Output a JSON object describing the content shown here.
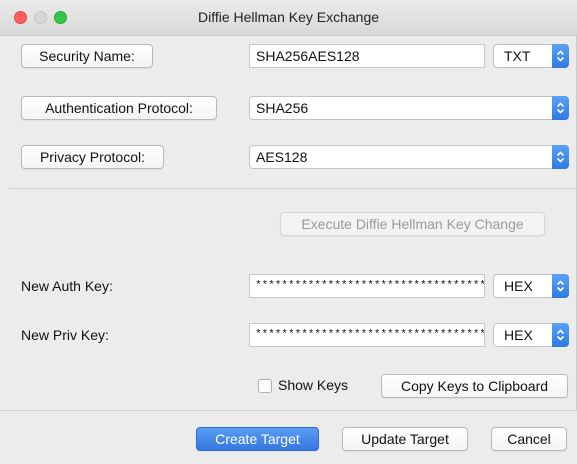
{
  "window": {
    "title": "Diffie Hellman Key Exchange"
  },
  "security": {
    "button_label": "Security Name:",
    "value": "SHA256AES128",
    "format": "TXT"
  },
  "auth": {
    "button_label": "Authentication Protocol:",
    "value": "SHA256"
  },
  "privacy": {
    "button_label": "Privacy Protocol:",
    "value": "AES128"
  },
  "execute_button": "Execute Diffie Hellman Key Change",
  "auth_key": {
    "label": "New Auth Key:",
    "value": "************************************",
    "format": "HEX"
  },
  "priv_key": {
    "label": "New Priv Key:",
    "value": "************************************",
    "format": "HEX"
  },
  "show_keys": {
    "label": "Show Keys",
    "checked": false
  },
  "copy_button": "Copy Keys to Clipboard",
  "footer": {
    "create": "Create Target",
    "update": "Update Target",
    "cancel": "Cancel"
  },
  "colors": {
    "accent": "#3577e0",
    "close": "#fc605c",
    "zoom": "#34c84a",
    "background": "#ececec"
  },
  "icons": {
    "stepper": "updown-chevron-icon"
  }
}
